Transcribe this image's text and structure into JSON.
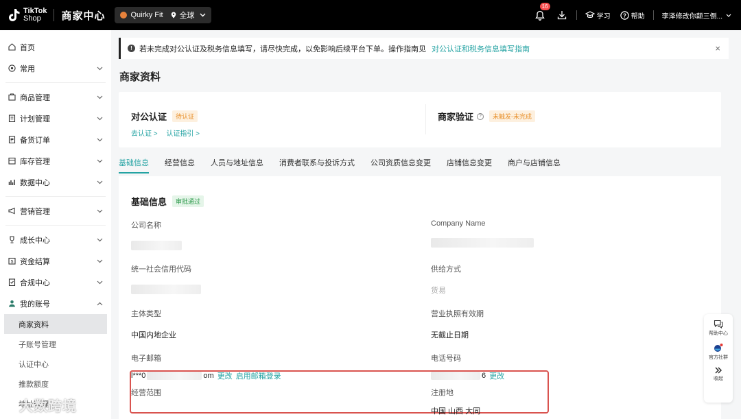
{
  "topbar": {
    "logo_line1": "TikTok",
    "logo_line2": "Shop",
    "center_title": "商家中心",
    "shop_name": "Quirky Fit",
    "region": "全球",
    "notification_count": "16",
    "learn": "学习",
    "help": "帮助",
    "user": "李泽修改你颠三倒..."
  },
  "sidebar": {
    "items": [
      {
        "label": "首页",
        "icon": "home-icon"
      },
      {
        "label": "常用",
        "icon": "star-icon"
      },
      {
        "label": "商品管理",
        "icon": "product-icon"
      },
      {
        "label": "计划管理",
        "icon": "plan-icon"
      },
      {
        "label": "备货订单",
        "icon": "order-icon"
      },
      {
        "label": "库存管理",
        "icon": "inventory-icon"
      },
      {
        "label": "数据中心",
        "icon": "chart-icon"
      },
      {
        "label": "营销管理",
        "icon": "megaphone-icon"
      },
      {
        "label": "成长中心",
        "icon": "trophy-icon"
      },
      {
        "label": "资金结算",
        "icon": "wallet-icon"
      },
      {
        "label": "合规中心",
        "icon": "compliance-icon"
      },
      {
        "label": "我的账号",
        "icon": "user-icon"
      }
    ],
    "sub_items": [
      "商家资料",
      "子账号管理",
      "认证中心",
      "推款额度",
      "地址管理"
    ]
  },
  "notice": {
    "text": "若未完成对公认证及税务信息填写，请尽快完成，以免影响后续平台下单。操作指南见",
    "link": "对公认证和税务信息填写指南"
  },
  "page_title": "商家资料",
  "cert": {
    "left_title": "对公认证",
    "left_tag": "待认证",
    "left_link1": "去认证 >",
    "left_link2": "认证指引 >",
    "right_title": "商家验证",
    "right_tag": "未触发-未完成"
  },
  "tabs": [
    "基础信息",
    "经营信息",
    "人员与地址信息",
    "消费者联系与投诉方式",
    "公司资质信息变更",
    "店铺信息变更",
    "商户与店铺信息"
  ],
  "basic": {
    "title": "基础信息",
    "tag": "审批通过",
    "company_name_label": "公司名称",
    "company_name_en_label": "Company Name",
    "credit_code_label": "统一社会信用代码",
    "supply_label": "供给方式",
    "supply_value": "货易",
    "entity_type_label": "主体类型",
    "entity_type_value": "中国内地企业",
    "license_label": "营业执照有效期",
    "license_value": "无截止日期",
    "email_label": "电子邮箱",
    "email_prefix": "l***0",
    "email_suffix": "om",
    "email_change": "更改",
    "email_login": "启用邮箱登录",
    "phone_label": "电话号码",
    "phone_suffix": "6",
    "phone_change": "更改",
    "scope_label": "经营范围",
    "reg_label": "注册地",
    "reg_value": "中国 山西 大同"
  },
  "float": {
    "help_center": "帮助中心",
    "community": "官方社群",
    "collapse": "收起"
  },
  "watermark": "大数跨境"
}
